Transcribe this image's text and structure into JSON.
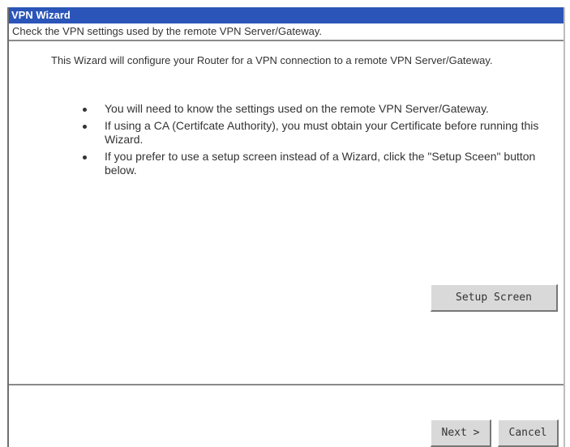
{
  "window": {
    "title": "VPN Wizard",
    "subtitle": "Check the VPN settings used by the remote VPN Server/Gateway."
  },
  "content": {
    "intro": "This Wizard will configure your Router for a VPN connection to a remote VPN Server/Gateway.",
    "bullets": [
      "You will need to know the settings used on the remote VPN Server/Gateway.",
      "If using a CA (Certifcate Authority), you must obtain your Certificate before running this Wizard.",
      "If you prefer to use a setup screen instead of a Wizard, click the \"Setup Sceen\" button below."
    ]
  },
  "buttons": {
    "setup_screen": "Setup Screen",
    "next": "Next >",
    "cancel": "Cancel"
  },
  "colors": {
    "title_bar": "#2b55b8",
    "button_face": "#d9d9d9"
  }
}
